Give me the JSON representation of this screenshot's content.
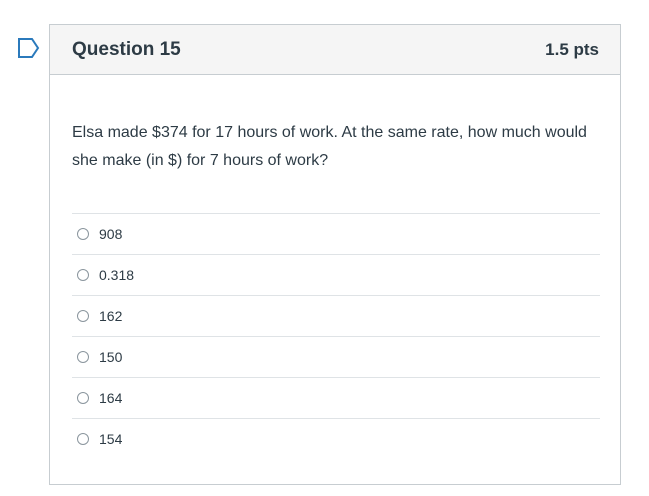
{
  "question": {
    "title": "Question 15",
    "points": "1.5 pts",
    "text": "Elsa made $374 for 17 hours of work. At the same rate, how much would she make (in $) for 7 hours of work?",
    "answers": [
      {
        "label": "908"
      },
      {
        "label": "0.318"
      },
      {
        "label": "162"
      },
      {
        "label": "150"
      },
      {
        "label": "164"
      },
      {
        "label": "154"
      }
    ]
  },
  "icons": {
    "flag": "flag-question-icon"
  },
  "colors": {
    "flag_accent": "#2b7abc",
    "header_bg": "#f5f5f5",
    "border": "#c7cdd1",
    "text": "#2d3b45"
  }
}
